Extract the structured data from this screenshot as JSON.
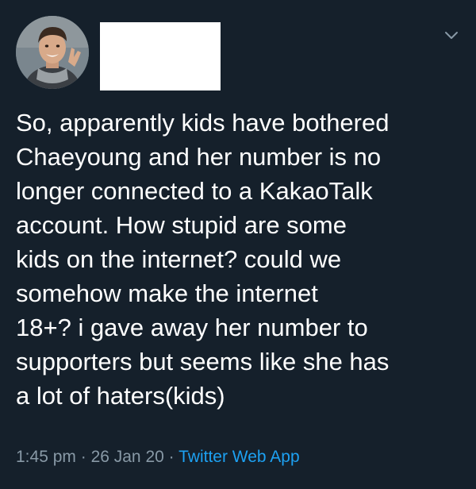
{
  "tweet": {
    "text": "So, apparently kids have bothered\nChaeyoung and her number is no\nlonger connected to a KakaoTalk\naccount. How stupid are some\nkids on the internet? could we\nsomehow make the internet\n18+? i gave away her number to\nsupporters but seems like she has\na lot of haters(kids)",
    "time": "1:45 pm",
    "date": "26 Jan 20",
    "separator": " · ",
    "source": "Twitter Web App"
  },
  "icons": {
    "avatar": "profile-photo",
    "menu": "chevron-down-icon"
  },
  "colors": {
    "background": "#15202b",
    "text": "#ffffff",
    "muted": "#8899a6",
    "link": "#1da1f2",
    "redaction": "#ffffff"
  }
}
